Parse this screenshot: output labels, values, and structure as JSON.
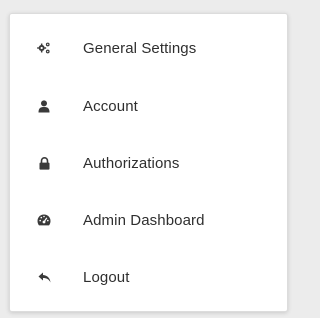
{
  "menu": {
    "items": [
      {
        "label": "General Settings",
        "icon": "gears-icon"
      },
      {
        "label": "Account",
        "icon": "user-icon"
      },
      {
        "label": "Authorizations",
        "icon": "lock-icon"
      },
      {
        "label": "Admin Dashboard",
        "icon": "dashboard-gauge-icon"
      },
      {
        "label": "Logout",
        "icon": "reply-arrow-icon"
      }
    ]
  },
  "colors": {
    "text": "#2f2f2f",
    "icon": "#3a3a3a",
    "background": "#ffffff",
    "border": "#dcdcdc"
  }
}
